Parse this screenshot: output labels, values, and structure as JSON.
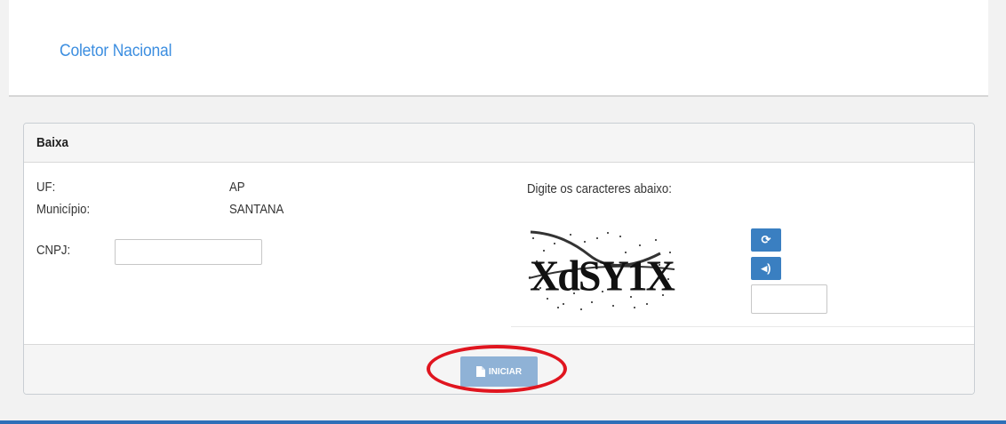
{
  "header": {
    "title": "Coletor Nacional"
  },
  "panel": {
    "heading": "Baixa",
    "fields": {
      "uf_label": "UF:",
      "uf_value": "AP",
      "municipio_label": "Município:",
      "municipio_value": "SANTANA",
      "cnpj_label": "CNPJ:",
      "cnpj_value": ""
    },
    "captcha": {
      "prompt": "Digite os caracteres abaixo:",
      "image_text": "XdSY1X",
      "refresh_icon": "refresh-icon",
      "audio_icon": "audio-icon",
      "input_value": ""
    },
    "footer": {
      "start_button_label": "INICIAR",
      "start_button_icon": "file-icon"
    }
  },
  "colors": {
    "brand_blue": "#3c8ee0",
    "button_blue": "#3a7fc1",
    "disabled_button": "#8fb2d6",
    "highlight_red": "#e0151f",
    "bottom_bar": "#2e6fb8"
  }
}
